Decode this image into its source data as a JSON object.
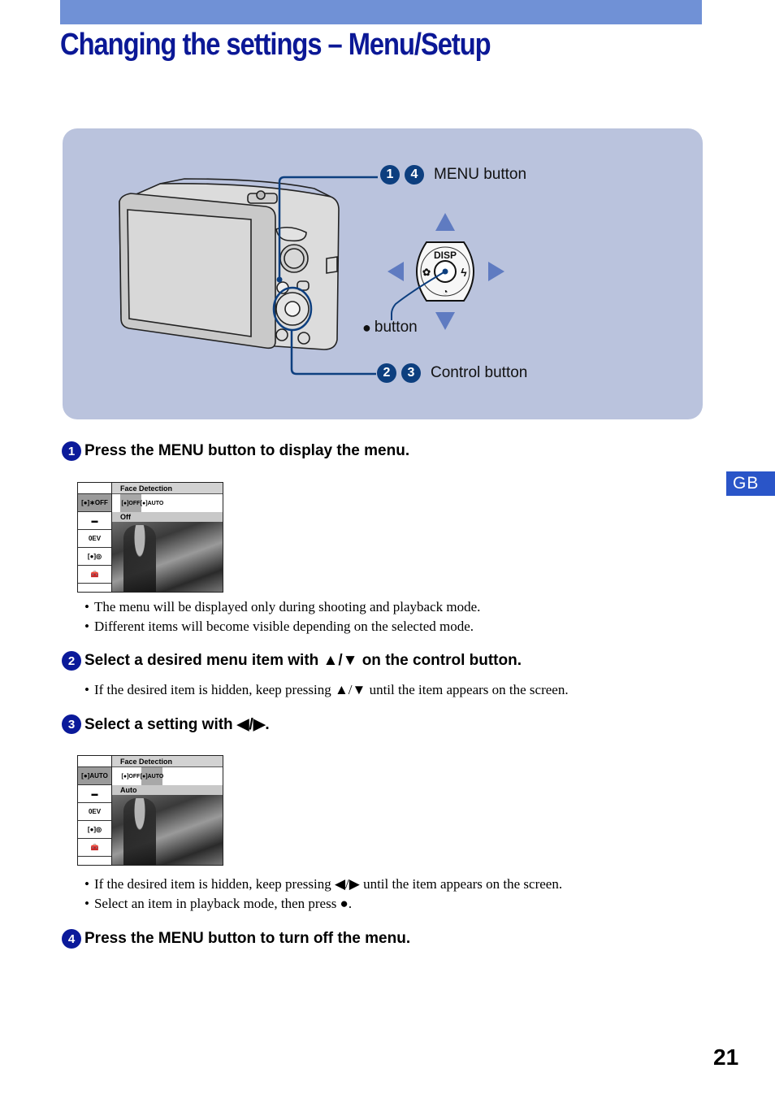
{
  "header": {
    "title": "Changing the settings – Menu/Setup",
    "band_color": "#7091d6",
    "title_color": "#0b1896"
  },
  "figure": {
    "callouts": {
      "menu": {
        "badges": [
          "1",
          "4"
        ],
        "label": "MENU button"
      },
      "center": {
        "glyph": "●",
        "label": "button"
      },
      "control": {
        "badges": [
          "2",
          "3"
        ],
        "label": "Control button"
      }
    },
    "dial_label": "DISP",
    "panel_color": "#bac3dd",
    "badge_color": "#0d3f7f"
  },
  "steps": [
    {
      "number": "1",
      "title": "Press the MENU button to display the menu.",
      "screen": {
        "header": "Face Detection",
        "value": "Off",
        "side_items": [
          "face-detection-off-icon",
          "image-size-icon",
          "0EV",
          "face-detection-mode-icon",
          "setup-toolbox-icon"
        ],
        "side_labels": [
          "[●]∗OFF",
          "▬",
          "0EV",
          "[●]◎",
          "🧰"
        ],
        "options": [
          "[●]OFF",
          "[●]AUTO"
        ],
        "selected_option": 0
      },
      "bullets": [
        "The menu will be displayed only during shooting and playback mode.",
        "Different items will become visible depending on the selected mode."
      ]
    },
    {
      "number": "2",
      "title": "Select a desired menu item with ▲/▼ on the control button.",
      "bullets": [
        "If the desired item is hidden, keep pressing ▲/▼ until the item appears on the screen."
      ]
    },
    {
      "number": "3",
      "title": "Select a setting with ◀/▶.",
      "screen": {
        "header": "Face Detection",
        "value": "Auto",
        "side_labels": [
          "[●]AUTO",
          "▬",
          "0EV",
          "[●]◎",
          "🧰"
        ],
        "options": [
          "[●]OFF",
          "[●]AUTO"
        ],
        "selected_option": 1
      },
      "bullets": [
        "If the desired item is hidden, keep pressing ◀/▶ until the item appears on the screen.",
        "Select an item in playback mode, then press ●."
      ]
    },
    {
      "number": "4",
      "title": "Press the MENU button to turn off the menu."
    }
  ],
  "bullet_glyph": "•",
  "language_tab": "GB",
  "page_number": "21"
}
